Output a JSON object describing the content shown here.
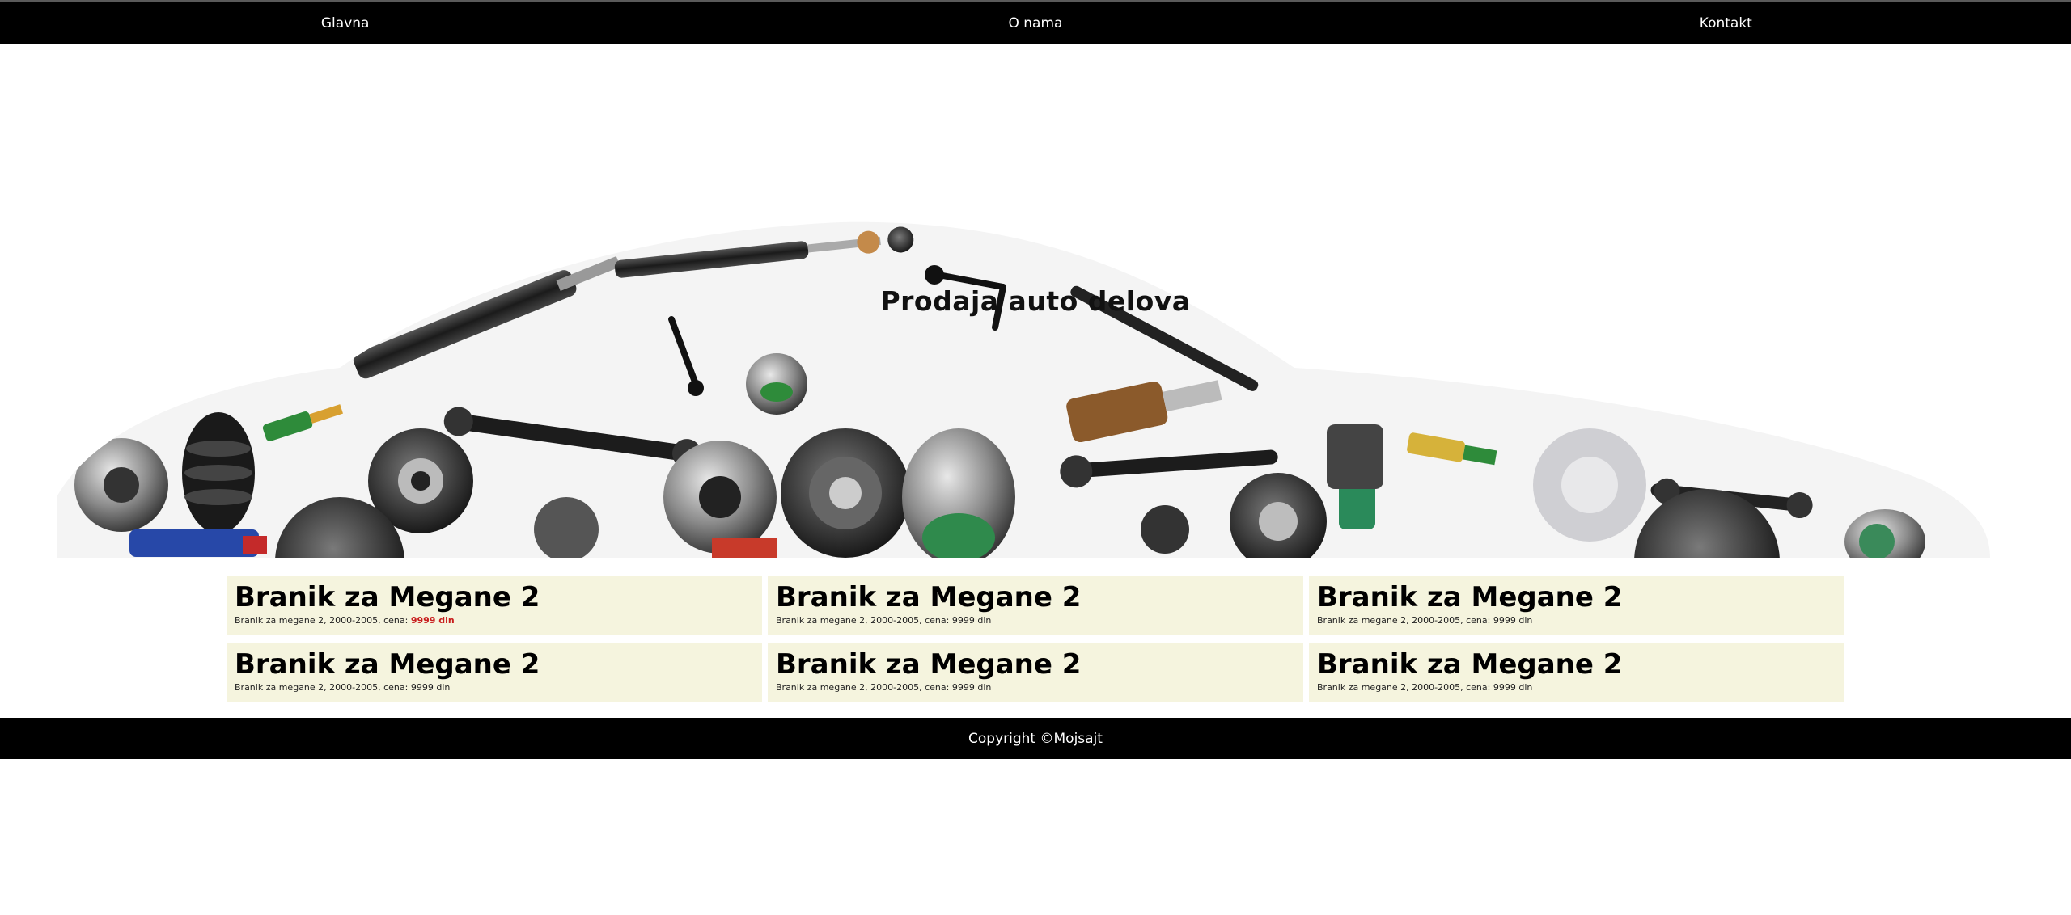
{
  "nav": {
    "items": [
      {
        "label": "Glavna"
      },
      {
        "label": "O nama"
      },
      {
        "label": "Kontakt"
      }
    ]
  },
  "hero": {
    "title": "Prodaja auto delova"
  },
  "products": [
    {
      "title": "Branik za Megane 2",
      "desc": "Branik za megane 2, 2000-2005, cena: ",
      "price": "9999 din",
      "price_highlight": true
    },
    {
      "title": "Branik za Megane 2",
      "desc": "Branik za megane 2, 2000-2005, cena: ",
      "price": "9999 din",
      "price_highlight": false
    },
    {
      "title": "Branik za Megane 2",
      "desc": "Branik za megane 2, 2000-2005, cena: ",
      "price": "9999 din",
      "price_highlight": false
    },
    {
      "title": "Branik za Megane 2",
      "desc": "Branik za megane 2, 2000-2005, cena: ",
      "price": "9999 din",
      "price_highlight": false
    },
    {
      "title": "Branik za Megane 2",
      "desc": "Branik za megane 2, 2000-2005, cena: ",
      "price": "9999 din",
      "price_highlight": false
    },
    {
      "title": "Branik za Megane 2",
      "desc": "Branik za megane 2, 2000-2005, cena: ",
      "price": "9999 din",
      "price_highlight": false
    }
  ],
  "footer": {
    "text": "Copyright ©Mojsajt"
  },
  "colors": {
    "nav_bg": "#000000",
    "card_bg": "#f5f4de",
    "price_highlight": "#c81e1e"
  }
}
